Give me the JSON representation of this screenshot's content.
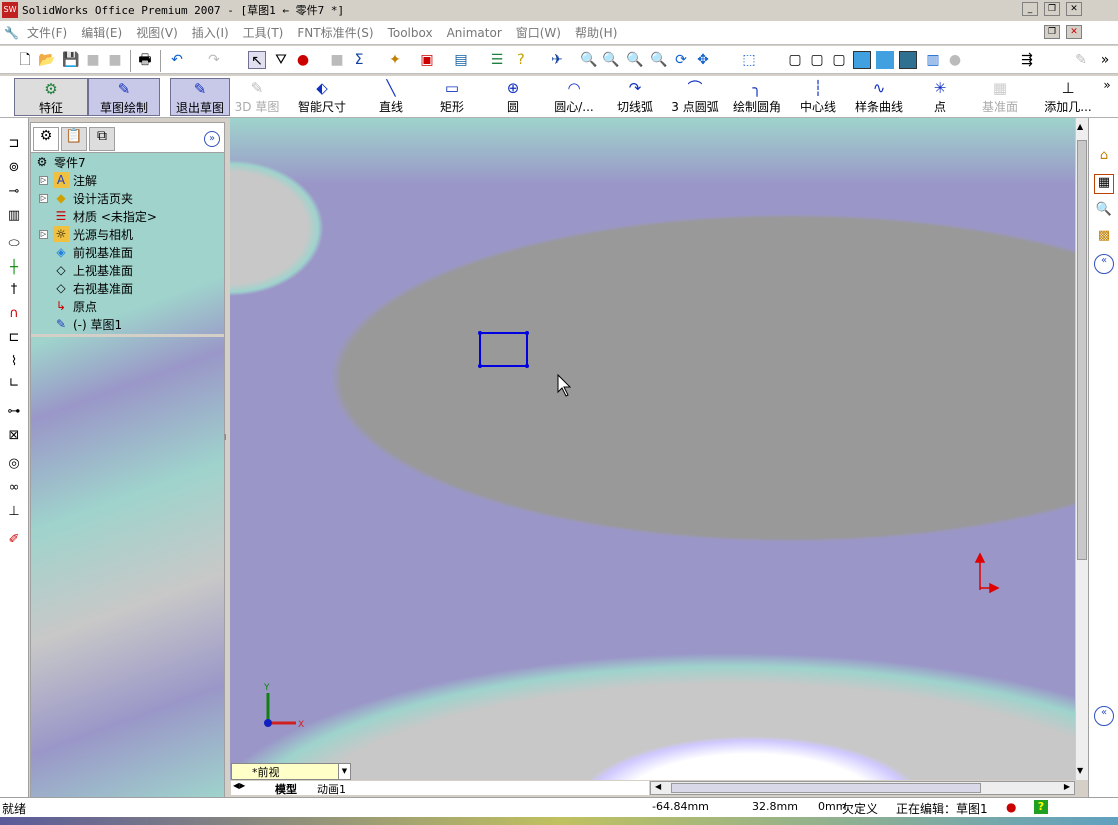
{
  "window": {
    "title": "SolidWorks Office Premium 2007 - [草图1 ← 零件7 *]",
    "controls": [
      "minimize",
      "restore",
      "close"
    ]
  },
  "menu": [
    "文件(F)",
    "编辑(E)",
    "视图(V)",
    "插入(I)",
    "工具(T)",
    "FNT标准件(S)",
    "Toolbox",
    "Animator",
    "窗口(W)",
    "帮助(H)"
  ],
  "commandmanager": {
    "features": "特征",
    "sketch": "草图绘制",
    "exit_sketch": "退出草图",
    "sketch3d": "3D 草图",
    "smart_dim": "智能尺寸",
    "line": "直线",
    "rectangle": "矩形",
    "circle": "圆",
    "center_arc": "圆心/...",
    "tangent_arc": "切线弧",
    "three_pt_arc": "3 点圆弧",
    "fillet": "绘制圆角",
    "centerline": "中心线",
    "spline": "样条曲线",
    "point": "点",
    "plane": "基准面",
    "add_relation": "添加几...",
    "more": "»"
  },
  "tree": {
    "root": "零件7",
    "items": [
      "注解",
      "设计活页夹",
      "材质 <未指定>",
      "光源与相机",
      "前视基准面",
      "上视基准面",
      "右视基准面",
      "原点",
      "(-) 草图1"
    ]
  },
  "view": {
    "orientation": "*前视",
    "tabs": [
      "模型",
      "动画1"
    ],
    "axis_x": "X",
    "axis_y": "Y"
  },
  "status": {
    "ready": "就绪",
    "x": "-64.84mm",
    "y": "32.8mm",
    "z": "0mm",
    "state": "欠定义",
    "editing": "正在编辑：草图1",
    "help": "?"
  },
  "colors": {
    "sketch": "#0000e0",
    "viewport_gray": "#999999",
    "viewport_purple": "#9a97c8",
    "viewport_teal": "#9fd3cc"
  }
}
